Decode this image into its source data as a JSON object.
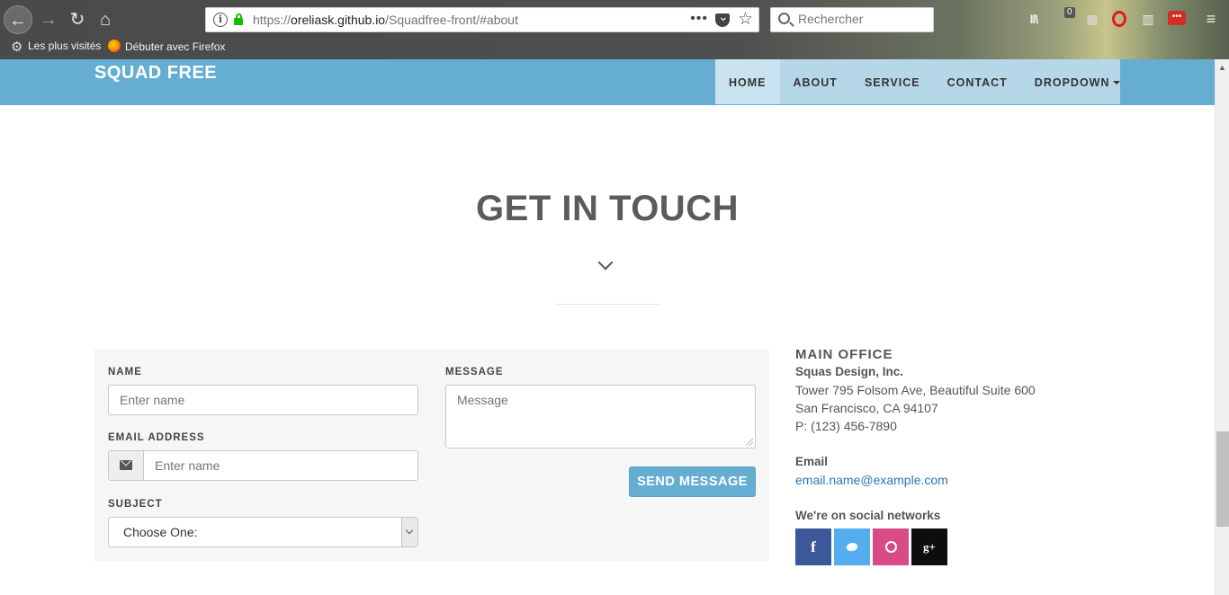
{
  "browser": {
    "url_prefix": "https://",
    "url_host": "oreliask.github.io",
    "url_path": "/Squadfree-front/#about",
    "page_actions": "•••",
    "search_placeholder": "Rechercher",
    "badge_count": "0",
    "bookmarks": [
      {
        "label": "Les plus visités",
        "icon": "gear-icon"
      },
      {
        "label": "Débuter avec Firefox",
        "icon": "firefox-icon"
      }
    ]
  },
  "site": {
    "brand": "SQUAD FREE",
    "nav": [
      {
        "label": "HOME",
        "active": true
      },
      {
        "label": "ABOUT"
      },
      {
        "label": "SERVICE"
      },
      {
        "label": "CONTACT"
      },
      {
        "label": "DROPDOWN"
      }
    ]
  },
  "section": {
    "title": "GET IN TOUCH"
  },
  "form": {
    "name_label": "NAME",
    "name_placeholder": "Enter name",
    "email_label": "EMAIL ADDRESS",
    "email_placeholder": "Enter name",
    "subject_label": "SUBJECT",
    "subject_value": "Choose One:",
    "message_label": "MESSAGE",
    "message_placeholder": "Message",
    "send_label": "SEND MESSAGE"
  },
  "contact": {
    "office_heading": "MAIN OFFICE",
    "company": "Squas Design, Inc.",
    "address_1": "Tower 795 Folsom Ave, Beautiful Suite 600",
    "address_2": "San Francisco, CA 94107",
    "phone": "P: (123) 456-7890",
    "email_heading": "Email",
    "email": "email.name@example.com",
    "social_heading": "We're on social networks",
    "social": [
      {
        "label": "f",
        "icon": "facebook-icon",
        "color": "#3b5998"
      },
      {
        "label": "",
        "icon": "twitter-icon",
        "color": "#55acee"
      },
      {
        "label": "",
        "icon": "dribbble-icon",
        "color": "#d94b85"
      },
      {
        "label": "g+",
        "icon": "google-plus-icon",
        "color": "#0d0d0d"
      }
    ]
  },
  "colors": {
    "header_blue": "#65aed1",
    "nav_bg": "#b6d7e8",
    "title_gray": "#5b5b5b"
  }
}
